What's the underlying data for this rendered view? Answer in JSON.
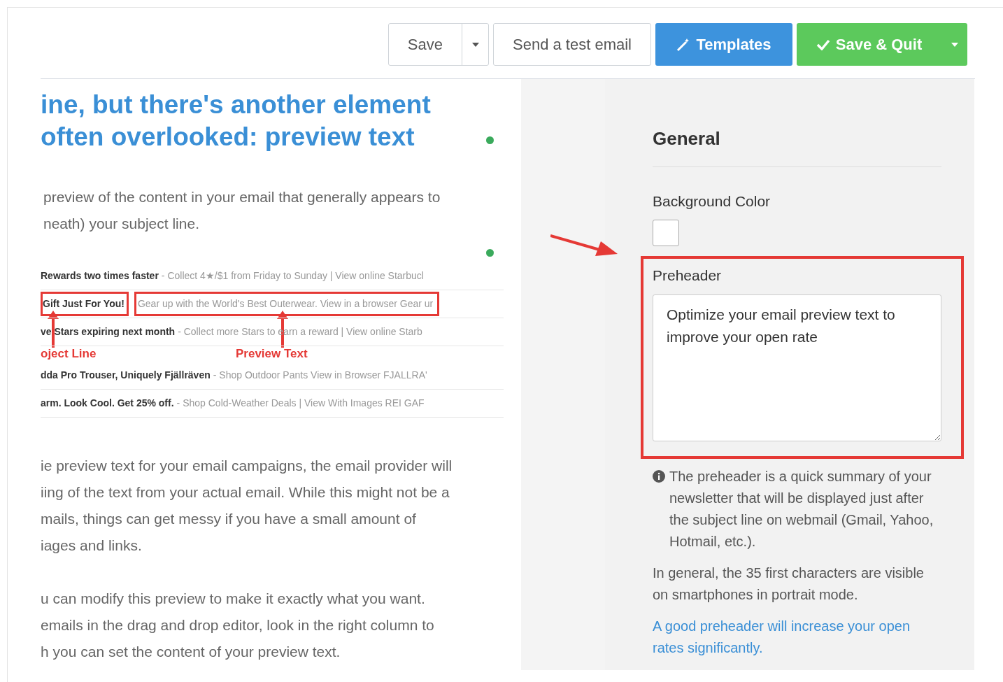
{
  "toolbar": {
    "save": "Save",
    "send_test": "Send a test email",
    "templates": "Templates",
    "save_quit": "Save & Quit"
  },
  "article": {
    "heading_lines": [
      "ine, but there's another element",
      "often overlooked: preview text"
    ],
    "intro_lines": [
      "preview of the content in your email that generally appears to",
      "neath) your subject line."
    ],
    "email_rows": [
      {
        "subject": "Rewards two times faster",
        "preview": "- Collect 4★/$1 from Friday to Sunday | View online Starbucl",
        "highlighted": false
      },
      {
        "subject": "Gift Just For You!",
        "preview": "Gear up with the World's Best Outerwear. View in a browser Gear ur",
        "highlighted": true
      },
      {
        "subject": "ve Stars expiring next month",
        "preview": "- Collect more Stars to earn a reward | View online Starb",
        "highlighted": false
      },
      {
        "subject": "dda Pro Trouser, Uniquely Fjällräven",
        "preview": "- Shop Outdoor Pants View in Browser FJALLRA'",
        "highlighted": false
      },
      {
        "subject": "arm. Look Cool. Get 25% off.",
        "preview": "- Shop Cold-Weather Deals | View With Images REI GAF",
        "highlighted": false
      }
    ],
    "annotations": {
      "subject_label": "oject Line",
      "preview_label": "Preview Text"
    },
    "paragraphs": [
      [
        "ie preview text for your email campaigns, the email provider will",
        "iing of the text from your actual email. While this might not be a",
        "mails, things can get messy if you have a small amount of",
        "iages and links."
      ],
      [
        "u can modify this preview to make it exactly what you want.",
        "emails in the drag and drop editor, look in the right column to",
        "h you can set the content of your preview text."
      ]
    ]
  },
  "settings": {
    "title": "General",
    "background_color": {
      "label": "Background Color",
      "color": "#ffffff"
    },
    "preheader": {
      "label": "Preheader",
      "value": "Optimize your email preview text to improve your open rate",
      "highlighted": true
    },
    "help": "The preheader is a quick summary of your newsletter that will be displayed just after the subject line on webmail (Gmail, Yahoo, Hotmail, etc.).",
    "note": "In general, the 35 first characters are visible on smartphones in portrait mode.",
    "link": "A good preheader will increase your open rates significantly."
  }
}
